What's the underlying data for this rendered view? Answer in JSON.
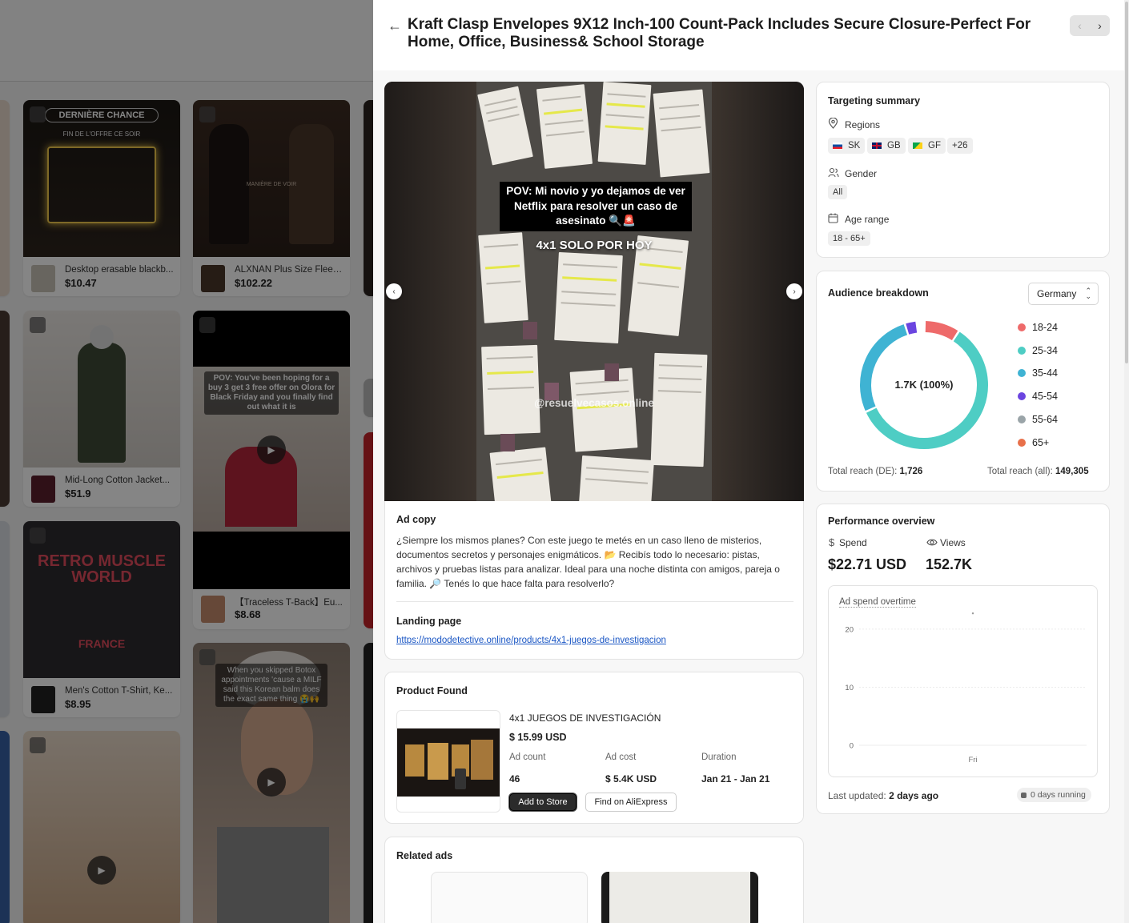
{
  "background_grid": {
    "cards": [
      {
        "title": "Desktop erasable blackb...",
        "price": "$10.47",
        "overlay": "DERNIÈRE CHANCE",
        "overlay2": "FIN DE L'OFFRE CE SOIR"
      },
      {
        "title": "ALXNAN Plus Size Fleec...",
        "price": "$102.22",
        "overlay": "MANIÈRE DE VOIR",
        "overlay2": ""
      },
      {
        "title": "Mid-Long Cotton Jacket...",
        "price": "$51.9",
        "overlay": "",
        "overlay2": ""
      },
      {
        "title": "【Traceless T-Back】Eu...",
        "price": "$8.68",
        "overlay": "POV: You've been hoping for a buy 3 get 3 free offer on Olora for Black Friday and you finally find out what it is",
        "overlay2": ""
      },
      {
        "title": "Men's Cotton T-Shirt, Ke...",
        "price": "$8.95",
        "overlay": "RETRO MUSCLE WORLD",
        "overlay2": "FRANCE"
      },
      {
        "title": "",
        "price": "",
        "overlay": "When you skipped Botox appointments 'cause a MILF said this Korean balm does the exact same thing 😭🙌",
        "overlay2": ""
      }
    ]
  },
  "header": {
    "back_icon": "arrow-left-icon",
    "title": "Kraft Clasp Envelopes 9X12 Inch-100 Count-Pack Includes Secure Closure-Perfect For Home, Office, Business& School Storage",
    "prev_icon": "chevron-left-icon",
    "next_icon": "chevron-right-icon"
  },
  "media": {
    "caption": "POV: Mi novio y yo dejamos de ver Netflix para resolver un caso de asesinato 🔍🚨",
    "promo": "4x1 SOLO POR HOY",
    "watermark": "@resuelvecasos.online"
  },
  "ad_copy": {
    "title": "Ad copy",
    "text": "¿Siempre los mismos planes? Con este juego te metés en un caso lleno de misterios, documentos secretos y personajes enigmáticos. 📂 Recibís todo lo necesario: pistas, archivos y pruebas listas para analizar. Ideal para una noche distinta con amigos, pareja o familia. 🔎 Tenés lo que hace falta para resolverlo?"
  },
  "landing_page": {
    "title": "Landing page",
    "url": "https://mododetective.online/products/4x1-juegos-de-investigacion"
  },
  "product_found": {
    "title": "Product Found",
    "name": "4x1 JUEGOS DE INVESTIGACIÓN",
    "price": "$ 15.99 USD",
    "ad_count_label": "Ad count",
    "ad_count": "46",
    "ad_cost_label": "Ad cost",
    "ad_cost": "$ 5.4K USD",
    "duration_label": "Duration",
    "duration": "Jan 21 - Jan 21",
    "add_button": "Add to Store",
    "find_button": "Find on AliExpress"
  },
  "related": {
    "title": "Related ads"
  },
  "targeting": {
    "title": "Targeting summary",
    "regions_label": "Regions",
    "regions": [
      {
        "code": "SK",
        "flag_colors": [
          "#ffffff",
          "#0b4ea2",
          "#ee1c25"
        ]
      },
      {
        "code": "GB",
        "flag_colors": [
          "#012169",
          "#ffffff",
          "#c8102e"
        ]
      },
      {
        "code": "GF",
        "flag_colors": [
          "#08a64a",
          "#fcd116",
          "#d21034"
        ]
      }
    ],
    "regions_more": "+26",
    "gender_label": "Gender",
    "gender": "All",
    "age_label": "Age range",
    "age": "18 - 65+"
  },
  "audience": {
    "title": "Audience breakdown",
    "country": "Germany",
    "center_label": "1.7K (100%)",
    "segments": [
      {
        "label": "18-24",
        "color": "#ee6a6a",
        "share": 0.09
      },
      {
        "label": "25-34",
        "color": "#4ecdc4",
        "share": 0.59
      },
      {
        "label": "35-44",
        "color": "#3fb3d3",
        "share": 0.27
      },
      {
        "label": "45-54",
        "color": "#6b45e0",
        "share": 0.03
      },
      {
        "label": "55-64",
        "color": "#9aa4a8",
        "share": 0.0
      },
      {
        "label": "65+",
        "color": "#e8704a",
        "share": 0.0
      }
    ],
    "reach_de_label": "Total reach (DE):",
    "reach_de": "1,726",
    "reach_all_label": "Total reach (all):",
    "reach_all": "149,305"
  },
  "performance": {
    "title": "Performance overview",
    "spend_label": "Spend",
    "spend": "$22.71 USD",
    "views_label": "Views",
    "views": "152.7K",
    "chart_title": "Ad spend overtime",
    "updated_label": "Last updated:",
    "updated": "2 days ago",
    "running": "0 days running"
  },
  "chart_data": {
    "type": "line",
    "title": "Ad spend overtime",
    "x": [
      "Fri"
    ],
    "series": [
      {
        "values": [
          22.71
        ]
      }
    ],
    "yticks": [
      0,
      10,
      20
    ],
    "ylim": [
      0,
      25
    ],
    "grid": true
  }
}
